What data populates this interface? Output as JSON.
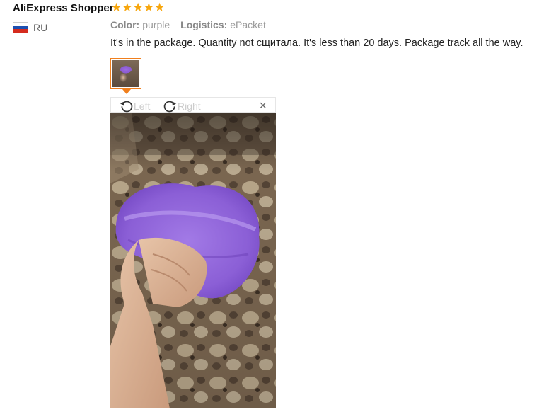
{
  "review": {
    "author": "AliExpress Shopper",
    "rating": 5,
    "country": "RU",
    "color_label": "Color:",
    "color_value": "purple",
    "logistics_label": "Logistics:",
    "logistics_value": "ePacket",
    "text": "It's in the package. Quantity not сщитала. It's less than 20 days. Package track all the way."
  },
  "viewer": {
    "rotate_left_label": "Left",
    "rotate_right_label": "Right",
    "close_symbol": "×"
  },
  "colors": {
    "star": "#f7a60d",
    "accent": "#f07f1d",
    "cap": "#8b5fd6"
  }
}
